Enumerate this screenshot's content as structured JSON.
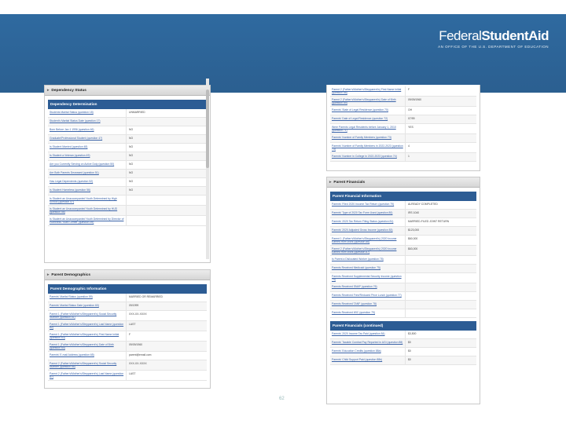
{
  "logo": {
    "word1": "Federal",
    "word2": "StudentAid",
    "tagline": "AN OFFICE OF THE U.S. DEPARTMENT OF EDUCATION"
  },
  "page_number": "62",
  "left_top": {
    "section": "Dependency Status",
    "table_header": "Dependency Determination",
    "rows": [
      {
        "k": "Students Marital Status (question 18)",
        "v": "UNMARRIED"
      },
      {
        "k": "Student's Marital Status Date (question 17)",
        "v": ""
      },
      {
        "k": "Born Before Jan 1 1996 (question 46)",
        "v": "NO"
      },
      {
        "k": "Graduate/Professional Student (question 47)",
        "v": "NO"
      },
      {
        "k": "Is Student Married (question 48)",
        "v": "NO"
      },
      {
        "k": "Is Student a Veteran (question 49)",
        "v": "NO"
      },
      {
        "k": "Are you Currently Serving on Active Duty (question 50)",
        "v": "NO"
      },
      {
        "k": "Are Both Parents Deceased (question 51)",
        "v": "NO"
      },
      {
        "k": "Has Legal Dependents (question 52)",
        "v": "NO"
      },
      {
        "k": "Is Student Homeless (question 56)",
        "v": "NO"
      },
      {
        "k": "Is Student an Unaccompanied Youth Determined by High School (question 57)",
        "v": ""
      },
      {
        "k": "Is Student an Unaccompanied Youth Determined by HUD (question 58)",
        "v": ""
      },
      {
        "k": "Is Student an Unaccompanied Youth Determined by Director of Homeless Youth Center (question 59)",
        "v": ""
      }
    ]
  },
  "left_bottom": {
    "section": "Parent Demographics",
    "table_header": "Parent Demographic Information",
    "rows": [
      {
        "k": "Parents' Marital Status (question 59)",
        "v": "MARRIED OR REMARRIED"
      },
      {
        "k": "Parents' Marital Status Date (question 60)",
        "v": "09/1999"
      },
      {
        "k": "Parent 1 (Father's/Mother's/Stepparent's) Social Security Number (question 61)",
        "v": "XXX-XX-XXXX"
      },
      {
        "k": "Parent 1 (Father's/Mother's/Stepparent's) Last Name (question 62)",
        "v": "LAST"
      },
      {
        "k": "Parent 1 (Father's/Mother's/Stepparent's) First Name Initial (question 63)",
        "v": "F"
      },
      {
        "k": "Parent 1 (Father's/Mother's/Stepparent's) Date of Birth (question 64)",
        "v": "09/09/1960"
      },
      {
        "k": "Parents' E-mail Address (question 65)",
        "v": "parent@email.com"
      },
      {
        "k": "Parent 2 (Father's/Mother's/Stepparent's) Social Security Number (question 66)",
        "v": "XXX-XX-XXXX"
      },
      {
        "k": "Parent 2 (Father's/Mother's/Stepparent's) Last Name (question 67)",
        "v": "LAST"
      }
    ]
  },
  "right_top": {
    "rows": [
      {
        "k": "Parent 2 (Father's/Mother's/Stepparent's) First Name Initial (question 68)",
        "v": "F"
      },
      {
        "k": "Parent 2 (Father's/Mother's/Stepparent's) Date of Birth (question 69)",
        "v": "09/09/1960"
      },
      {
        "k": "Parents' State of Legal Residence (question 70)",
        "v": "OH"
      },
      {
        "k": "Parents' Date of Legal Residence (question 72)",
        "v": "07/99"
      },
      {
        "k": "Were Parents Legal Residents before January 1, 2010 (question 71)",
        "v": "YES"
      },
      {
        "k": "Parents' Number of Family Members (question 73)",
        "v": ""
      },
      {
        "k": "Parents' Number of Family Members in 2022-2023 (question 73)",
        "v": "4"
      },
      {
        "k": "Parents' Number in College in 2022-2023 (question 74)",
        "v": "1"
      }
    ]
  },
  "right_mid": {
    "section": "Parent Financials",
    "table_header": "Parent Financial Information",
    "rows": [
      {
        "k": "Parents' Filed 2020 Income Tax Return (question 79)",
        "v": "ALREADY COMPLETED"
      },
      {
        "k": "Parents' Type of 2020 Tax Form Used (question 80)",
        "v": "IRS 1040"
      },
      {
        "k": "Parents' 2020 Tax Return Filing Status (question 81)",
        "v": "MARRIED-FILED JOINT RETURN"
      },
      {
        "k": "Parents' 2020 Adjusted Gross Income (question 83)",
        "v": "$123,000"
      },
      {
        "k": "Parent 1 (Father's/Mother's/Stepparent's) 2020 Income Earned from Work (question 86)",
        "v": "$60,000"
      },
      {
        "k": "Parent 2 (Father's/Mother's/Stepparent's) 2020 Income Earned from Work (question 87)",
        "v": "$63,000"
      },
      {
        "k": "Is Parent a Dislocated Worker (question 78)",
        "v": ""
      },
      {
        "k": "Parents Received Medicaid (question 75)",
        "v": ""
      },
      {
        "k": "Parents Received Supplemental Security Income (question 74)",
        "v": ""
      },
      {
        "k": "Parents Received SNAP (question 76)",
        "v": ""
      },
      {
        "k": "Parents Received Free/Reduced Price Lunch (question 77)",
        "v": ""
      },
      {
        "k": "Parents Received TANF (question 78)",
        "v": ""
      },
      {
        "k": "Parents Received WIC (question 79)",
        "v": ""
      }
    ]
  },
  "right_bottom": {
    "table_header": "Parent Financials (continued)",
    "rows": [
      {
        "k": "Parents' 2020 Income Tax Paid (question 84)",
        "v": "$3,500"
      },
      {
        "k": "Parents' Taxable Combat Pay Reported in AGI (question 88)",
        "v": "$0"
      },
      {
        "k": "Parents' Education Credits (question 88a)",
        "v": "$0"
      },
      {
        "k": "Parents' Child Support Paid (question 88b)",
        "v": "$0"
      }
    ]
  }
}
